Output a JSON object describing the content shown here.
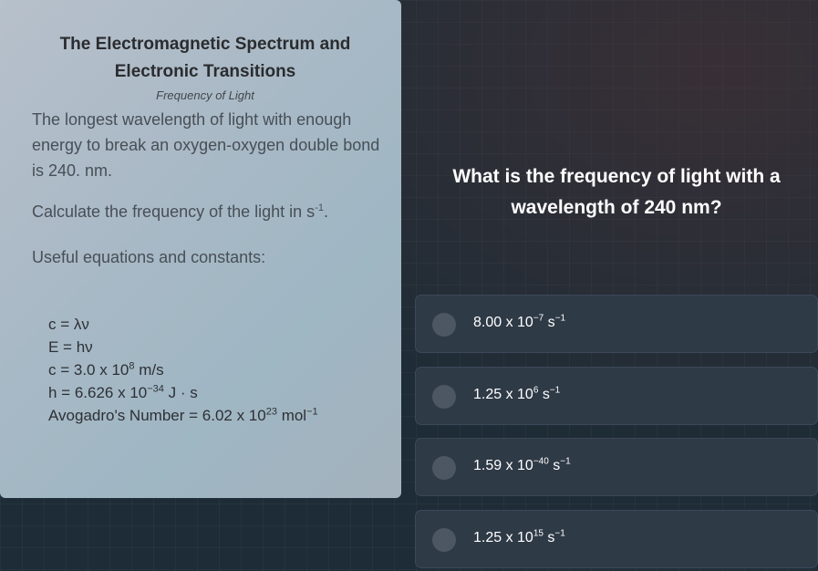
{
  "card": {
    "title_line1": "The Electromagnetic Spectrum and",
    "title_line2": "Electronic Transitions",
    "subtitle": "Frequency of Light",
    "problem_text": "The longest wavelength of light with enough energy to break an oxygen-oxygen double bond is 240. nm.",
    "prompt_text": "Calculate the frequency of the light in s",
    "prompt_exp": "-1",
    "prompt_end": ".",
    "useful_label": "Useful equations and constants:",
    "equations": {
      "eq1": "c = λν",
      "eq2": "E = hν",
      "eq3_base": "c = 3.0 x 10",
      "eq3_exp": "8",
      "eq3_unit": " m/s",
      "eq4_base": "h = 6.626 x 10",
      "eq4_exp": "−34",
      "eq4_unit": " J · s",
      "eq5_base": "Avogadro's Number = 6.02 x 10",
      "eq5_exp": "23",
      "eq5_unit": " mol",
      "eq5_unit_exp": "−1"
    }
  },
  "question": "What is the frequency of light with a wavelength of 240 nm?",
  "options": [
    {
      "mantissa": "8.00 x 10",
      "exp": "−7",
      "unit": " s",
      "unit_exp": "−1"
    },
    {
      "mantissa": "1.25 x 10",
      "exp": "6",
      "unit": " s",
      "unit_exp": "−1"
    },
    {
      "mantissa": "1.59 x 10",
      "exp": "−40",
      "unit": " s",
      "unit_exp": "−1"
    },
    {
      "mantissa": "1.25 x 10",
      "exp": "15",
      "unit": " s",
      "unit_exp": "−1"
    }
  ]
}
